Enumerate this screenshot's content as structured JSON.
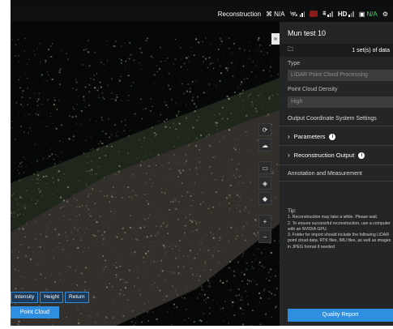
{
  "topbar": {
    "mode": "Reconstruction",
    "rtk_value": "N/A",
    "hd_label": "HD",
    "camera_value": "N/A"
  },
  "panel": {
    "title": "Mun test 10",
    "data_count": "1 set(s) of data",
    "type_label": "Type",
    "type_value": "LiDAR Point Cloud Processing",
    "density_label": "Point Cloud Density",
    "density_value": "High",
    "output_label": "Output Coordinate System Settings",
    "parameters_label": "Parameters",
    "recon_output_label": "Reconstruction Output",
    "annotation_label": "Annotation and Measurement",
    "tip_title": "Tip:",
    "tips": [
      "1. Reconstruction may take a while. Please wait.",
      "2. To ensure successful reconstruction, use a computer with an NVIDIA GPU.",
      "3. Folder for import should include the following LiDAR point cloud data, RTK files, IMU files, as well as images in JPEG format if needed"
    ],
    "quality_report": "Quality Report"
  },
  "viewport": {
    "tabs": [
      "Intensity",
      "Height",
      "Return"
    ],
    "point_cloud": "Point Cloud"
  },
  "colors": {
    "accent": "#2e8fe0",
    "panel": "#232527"
  },
  "icons": [
    "collapse-panel-icon",
    "rtk-icon",
    "satellite-signal-icon",
    "gear-icon",
    "folder-icon",
    "rotate-icon",
    "cloud-icon",
    "square-view-icon",
    "cube-icon",
    "solid-cube-icon",
    "zoom-in-icon",
    "zoom-out-icon"
  ]
}
